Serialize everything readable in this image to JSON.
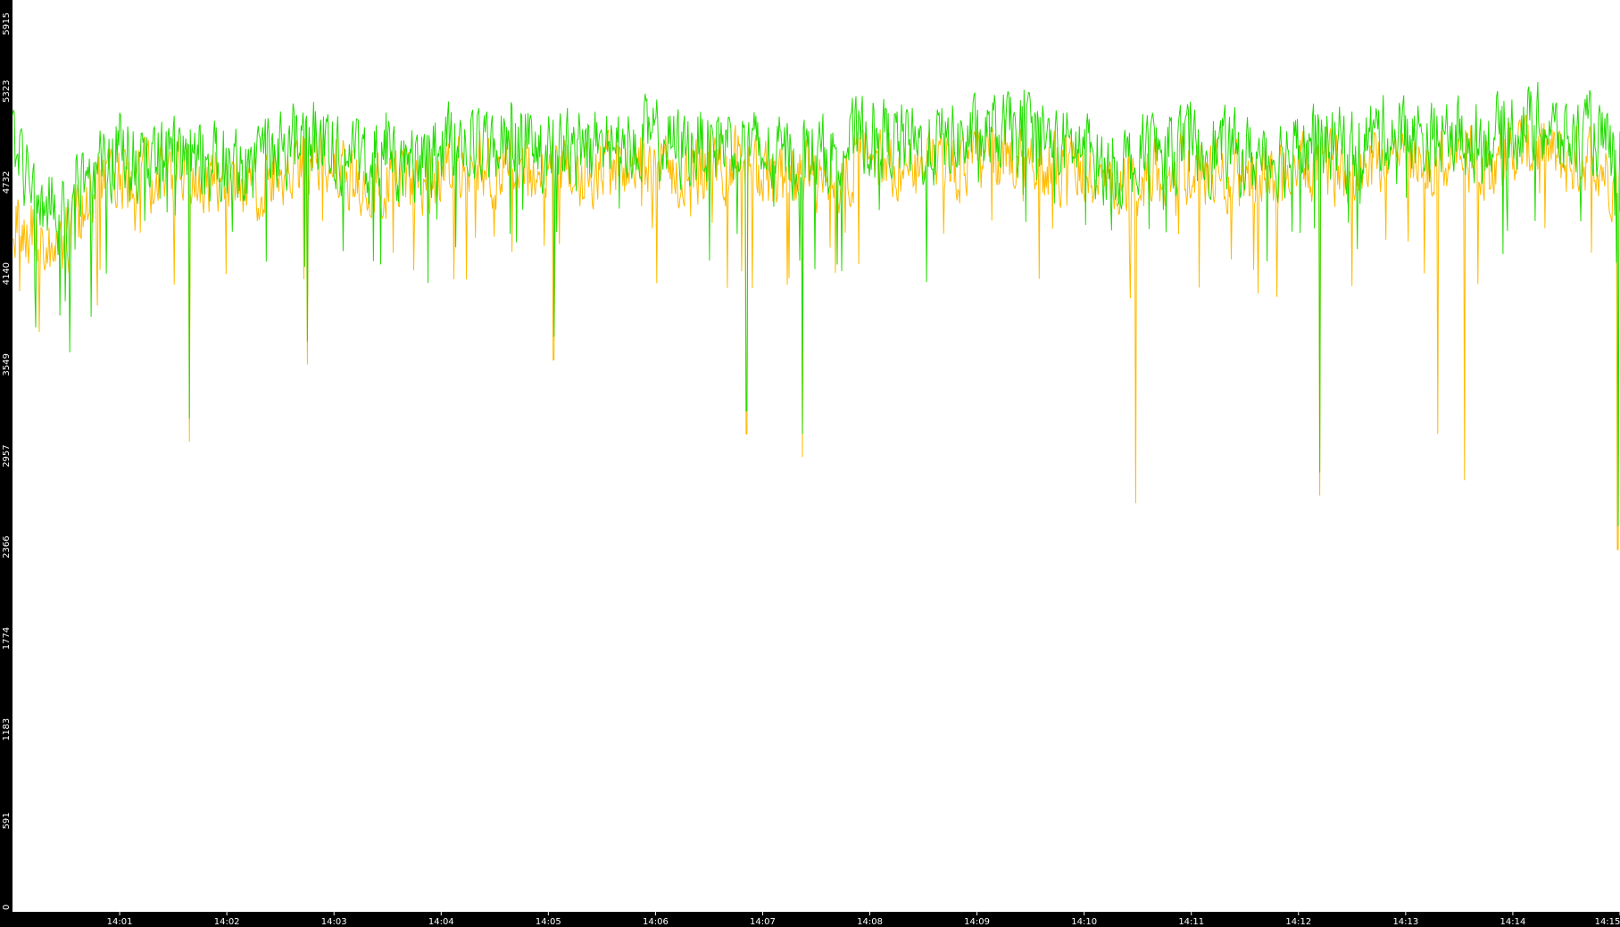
{
  "chart_data": {
    "type": "line",
    "title": "",
    "xlabel": "",
    "ylabel": "",
    "grid": false,
    "legend": "none",
    "colors": {
      "background": "#000000",
      "plot_area": "#ffffff",
      "axis_text": "#ffffff",
      "series_green": "#22dd00",
      "series_orange": "#ffbb00"
    },
    "y_ticks": [
      "0",
      "591",
      "1183",
      "1774",
      "2366",
      "2957",
      "3549",
      "4140",
      "4732",
      "5323",
      "5915"
    ],
    "ylim": [
      0,
      5915
    ],
    "x_ticks": [
      "14:01",
      "14:02",
      "14:03",
      "14:04",
      "14:05",
      "14:06",
      "14:07",
      "14:08",
      "14:09",
      "14:10",
      "14:11",
      "14:12",
      "14:13",
      "14:14",
      "14:15"
    ],
    "x_range_minutes": [
      0,
      15
    ],
    "sample_count": 1800,
    "series": [
      {
        "color": "#22dd00",
        "baseline_values": [
          5000,
          4600,
          4500,
          4750,
          4950,
          4850,
          4900,
          4900,
          4850,
          4800,
          4950,
          5050,
          5000,
          4850,
          4900,
          4850,
          4950,
          5000,
          4950,
          5050,
          4900,
          4950,
          4950,
          5050,
          5000,
          4950,
          5000,
          5000,
          4900,
          4900,
          4900,
          4950,
          5050,
          5000,
          4950,
          5000,
          5000,
          5050,
          5050,
          4950,
          4950,
          4800,
          4900,
          4950,
          4950,
          4950,
          4900,
          4900,
          4950,
          5000,
          4950,
          5050,
          5050,
          5000,
          5050,
          5000,
          5100,
          5100,
          5000,
          5050,
          4850
        ]
      },
      {
        "color": "#ffbb00",
        "baseline_values": [
          4500,
          4350,
          4350,
          4650,
          4800,
          4750,
          4800,
          4750,
          4750,
          4700,
          4800,
          4850,
          4850,
          4700,
          4750,
          4700,
          4800,
          4850,
          4800,
          4900,
          4750,
          4800,
          4800,
          4900,
          4850,
          4800,
          4850,
          4850,
          4750,
          4750,
          4750,
          4800,
          4900,
          4850,
          4800,
          4850,
          4850,
          4900,
          4900,
          4800,
          4800,
          4650,
          4750,
          4800,
          4800,
          4800,
          4750,
          4750,
          4800,
          4850,
          4800,
          4900,
          4900,
          4850,
          4900,
          4850,
          4950,
          4950,
          4850,
          4900,
          4700
        ]
      }
    ],
    "notable_dips": [
      {
        "x_min": 1.65,
        "value": 3050
      },
      {
        "x_min": 2.75,
        "value": 3550
      },
      {
        "x_min": 5.05,
        "value": 3580
      },
      {
        "x_min": 6.85,
        "value": 3100
      },
      {
        "x_min": 7.37,
        "value": 2950
      },
      {
        "x_min": 10.48,
        "value": 2650
      },
      {
        "x_min": 12.2,
        "value": 2700
      },
      {
        "x_min": 13.3,
        "value": 3100
      },
      {
        "x_min": 13.55,
        "value": 2800
      },
      {
        "x_min": 14.98,
        "value": 2350
      }
    ]
  }
}
